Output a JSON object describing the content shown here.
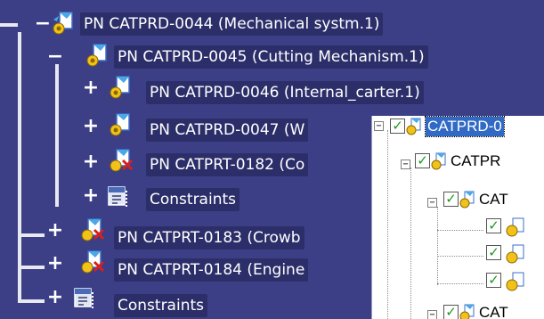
{
  "tree": {
    "nodes": [
      {
        "label": "PN CATPRD-0044 (Mechanical systm.1)",
        "icon": "product-assembly-icon",
        "expander": "collapse"
      },
      {
        "label": "PN CATPRD-0045 (Cutting Mechanism.1)",
        "icon": "product-assembly-icon",
        "expander": "collapse"
      },
      {
        "label": "PN CATPRD-0046 (Internal_carter.1)",
        "icon": "product-assembly-icon",
        "expander": "expand"
      },
      {
        "label": "PN CATPRD-0047 (W",
        "icon": "product-assembly-icon",
        "expander": "expand"
      },
      {
        "label": "PN CATPRT-0182 (Co",
        "icon": "part-icon",
        "expander": "expand"
      },
      {
        "label": "Constraints",
        "icon": "constraints-icon",
        "expander": "expand"
      },
      {
        "label": "PN CATPRT-0183 (Crowb",
        "icon": "part-icon",
        "expander": "expand"
      },
      {
        "label": "PN CATPRT-0184 (Engine",
        "icon": "part-icon",
        "expander": "expand"
      },
      {
        "label": "Constraints",
        "icon": "constraints-icon",
        "expander": "expand"
      }
    ]
  },
  "panel": {
    "rows": [
      {
        "label": "CATPRD-0",
        "selected": true,
        "checked": true,
        "expander": "−"
      },
      {
        "label": "CATPR",
        "selected": false,
        "checked": true,
        "expander": "−"
      },
      {
        "label": "CAT",
        "selected": false,
        "checked": true,
        "expander": "−"
      },
      {
        "label": "",
        "selected": false,
        "checked": true,
        "expander": ""
      },
      {
        "label": "",
        "selected": false,
        "checked": true,
        "expander": ""
      },
      {
        "label": "",
        "selected": false,
        "checked": true,
        "expander": ""
      },
      {
        "label": "CAT",
        "selected": false,
        "checked": true,
        "expander": "−"
      }
    ]
  },
  "colors": {
    "background": "#3d3f86",
    "label_background": "#2c2e6a",
    "selection": "#316ac5",
    "check": "#1a9a1a"
  }
}
